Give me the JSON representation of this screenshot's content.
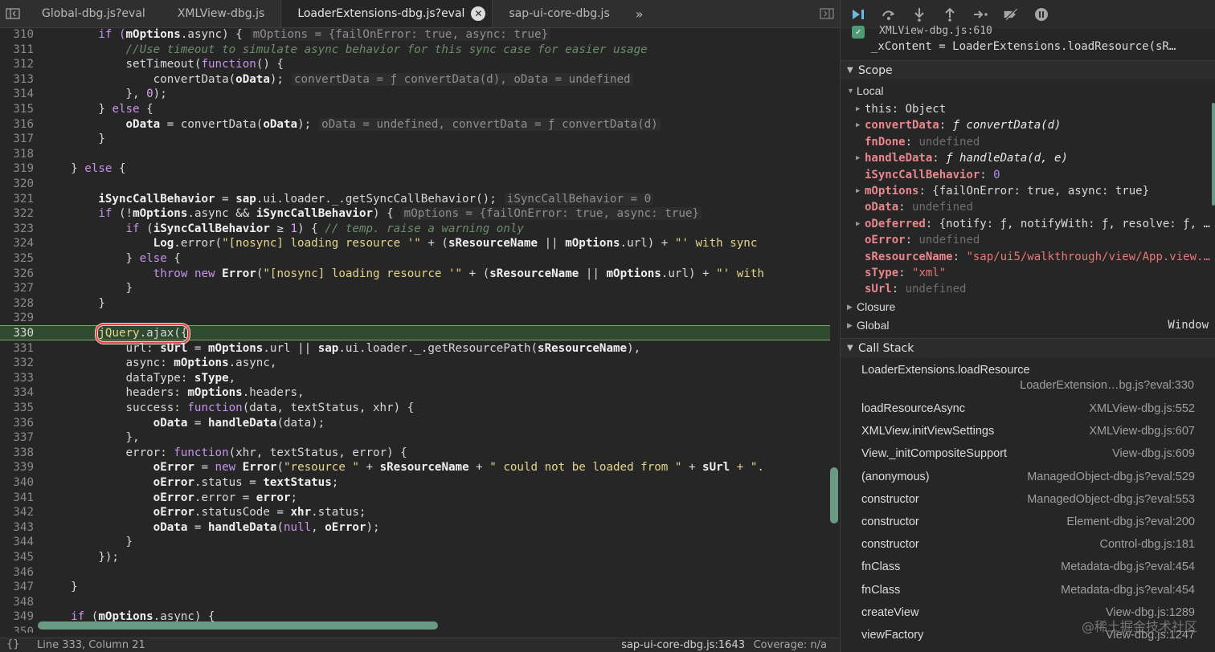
{
  "tabs": [
    {
      "label": "Global-dbg.js?eval"
    },
    {
      "label": "XMLView-dbg.js"
    },
    {
      "label": "LoaderExtensions-dbg.js?eval",
      "active": true
    },
    {
      "label": "sap-ui-core-dbg.js"
    }
  ],
  "icons": {
    "sidebar_toggle": "sidebar-toggle-icon",
    "close": "close-icon",
    "overflow": "double-chevron-right-icon",
    "right_panel": "panel-right-icon"
  },
  "colors": {
    "exec_line_bg": "#2f4a2e",
    "exec_line_border": "#6fb15f",
    "highlight_box": "#e04343",
    "keyword": "#c792ea",
    "scrollbar": "#6b9a84"
  },
  "code": {
    "lines": [
      {
        "n": "310"
      },
      {
        "n": "311"
      },
      {
        "n": "312"
      },
      {
        "n": "313"
      },
      {
        "n": "314"
      },
      {
        "n": "315"
      },
      {
        "n": "316"
      },
      {
        "n": "317"
      },
      {
        "n": "318"
      },
      {
        "n": "319"
      },
      {
        "n": "320"
      },
      {
        "n": "321"
      },
      {
        "n": "322"
      },
      {
        "n": "323"
      },
      {
        "n": "324"
      },
      {
        "n": "325"
      },
      {
        "n": "326"
      },
      {
        "n": "327"
      },
      {
        "n": "328"
      },
      {
        "n": "329"
      },
      {
        "n": "330"
      },
      {
        "n": "331"
      },
      {
        "n": "332"
      },
      {
        "n": "333"
      },
      {
        "n": "334"
      },
      {
        "n": "335"
      },
      {
        "n": "336"
      },
      {
        "n": "337"
      },
      {
        "n": "338"
      },
      {
        "n": "339"
      },
      {
        "n": "340"
      },
      {
        "n": "341"
      },
      {
        "n": "342"
      },
      {
        "n": "343"
      },
      {
        "n": "344"
      },
      {
        "n": "345"
      },
      {
        "n": "346"
      },
      {
        "n": "347"
      },
      {
        "n": "348"
      },
      {
        "n": "349"
      },
      {
        "n": "350"
      }
    ],
    "text": {
      "l310_a": "if (",
      "l310_b": "mOptions",
      "l310_c": ".async) {",
      "l310_inl": "mOptions = {failOnError: true, async: true}",
      "l311": "//Use timeout to simulate async behavior for this sync case for easier usage",
      "l312_a": "setTimeout(",
      "l312_b": "function",
      "l312_c": "() {",
      "l313_a": "convertData(",
      "l313_b": "oData",
      "l313_c": ");",
      "l313_inl": "convertData = ƒ convertData(d), oData = undefined",
      "l314_a": "}, ",
      "l314_b": "0",
      "l314_c": ");",
      "l315_a": "} ",
      "l315_b": "else",
      "l315_c": " {",
      "l316_a": "oData",
      "l316_b": " = convertData(",
      "l316_c": "oData",
      "l316_d": ");",
      "l316_inl": "oData = undefined, convertData = ƒ convertData(d)",
      "l317": "}",
      "l319_a": "} ",
      "l319_b": "else",
      "l319_c": " {",
      "l321_a": "iSyncCallBehavior",
      "l321_b": " = ",
      "l321_c": "sap",
      "l321_d": ".ui.loader._.getSyncCallBehavior();",
      "l321_inl": "iSyncCallBehavior = 0",
      "l322_a": "if",
      "l322_b": " (!",
      "l322_c": "mOptions",
      "l322_d": ".async && ",
      "l322_e": "iSyncCallBehavior",
      "l322_f": ") {",
      "l322_inl": "mOptions = {failOnError: true, async: true}",
      "l323_a": "if",
      "l323_b": " (",
      "l323_c": "iSyncCallBehavior",
      "l323_d": " ≥ ",
      "l323_e": "1",
      "l323_f": ") { ",
      "l323_g": "// temp. raise a warning only",
      "l324_a": "Log",
      "l324_b": ".error(",
      "l324_c": "\"[nosync] loading resource '\"",
      "l324_d": " + (",
      "l324_e": "sResourceName",
      "l324_f": " || ",
      "l324_g": "mOptions",
      "l324_h": ".url) + ",
      "l324_i": "\"' with sync",
      "l325_a": "} ",
      "l325_b": "else",
      "l325_c": " {",
      "l326_a": "throw",
      "l326_b": " ",
      "l326_c": "new",
      "l326_d": " ",
      "l326_e": "Error",
      "l326_f": "(",
      "l326_g": "\"[nosync] loading resource '\"",
      "l326_h": " + (",
      "l326_i": "sResourceName",
      "l326_j": " || ",
      "l326_k": "mOptions",
      "l326_l": ".url) + ",
      "l326_m": "\"' with",
      "l327": "}",
      "l328": "}",
      "l330_a": "jQuery",
      "l330_b": ".ajax({",
      "l331_a": "url: ",
      "l331_b": "sUrl",
      "l331_c": " = ",
      "l331_d": "mOptions",
      "l331_e": ".url || ",
      "l331_f": "sap",
      "l331_g": ".ui.loader._.getResourcePath(",
      "l331_h": "sResourceName",
      "l331_i": "),",
      "l332_a": "async: ",
      "l332_b": "mOptions",
      "l332_c": ".async,",
      "l333_a": "dataType: ",
      "l333_b": "sType",
      "l333_c": ",",
      "l334_a": "headers: ",
      "l334_b": "mOptions",
      "l334_c": ".headers,",
      "l335_a": "success: ",
      "l335_b": "function",
      "l335_c": "(data, textStatus, xhr) {",
      "l336_a": "oData",
      "l336_b": " = ",
      "l336_c": "handleData",
      "l336_d": "(data);",
      "l337": "},",
      "l338_a": "error: ",
      "l338_b": "function",
      "l338_c": "(xhr, textStatus, error) {",
      "l339_a": "oError",
      "l339_b": " = ",
      "l339_c": "new",
      "l339_d": " ",
      "l339_e": "Error",
      "l339_f": "(",
      "l339_g": "\"resource \"",
      "l339_h": " + ",
      "l339_i": "sResourceName",
      "l339_j": " + ",
      "l339_k": "\" could not be loaded from \"",
      "l339_l": " + ",
      "l339_m": "sUrl",
      "l339_n": " + \".",
      "l340_a": "oError",
      "l340_b": ".status = ",
      "l340_c": "textStatus",
      "l340_d": ";",
      "l341_a": "oError",
      "l341_b": ".error = ",
      "l341_c": "error",
      "l341_d": ";",
      "l342_a": "oError",
      "l342_b": ".statusCode = ",
      "l342_c": "xhr",
      "l342_d": ".status;",
      "l343_a": "oData",
      "l343_b": " = ",
      "l343_c": "handleData",
      "l343_d": "(",
      "l343_e": "null",
      "l343_f": ", ",
      "l343_g": "oError",
      "l343_h": ");",
      "l344": "}",
      "l345": "});",
      "l347": "}",
      "l349_a": "if",
      "l349_b": " (",
      "l349_c": "mOptions",
      "l349_d": ".async) {"
    }
  },
  "status": {
    "curly": "{}",
    "position": "Line 333, Column 21",
    "file": "sap-ui-core-dbg.js:1643",
    "coverage": "Coverage: n/a"
  },
  "debugger": {
    "toolbar": [
      {
        "name": "resume-icon",
        "glyph": "▶▍"
      },
      {
        "name": "step-over-icon",
        "glyph": "↷"
      },
      {
        "name": "step-into-icon",
        "glyph": "⤓"
      },
      {
        "name": "step-out-icon",
        "glyph": "⤒"
      },
      {
        "name": "step-icon",
        "glyph": "→•"
      },
      {
        "name": "deactivate-breakpoints-icon",
        "glyph": "⧸"
      },
      {
        "name": "pause-exceptions-icon",
        "glyph": "⏸"
      }
    ],
    "peek_line1": "XMLView-dbg.js:610",
    "peek_line2": "_xContent = LoaderExtensions.loadResource(sR…",
    "scope_title": "Scope",
    "local_title": "Local",
    "scope": [
      {
        "key": "this",
        "sep": ": ",
        "val": "Object",
        "expandable": true,
        "plain": true,
        "vt": "obj"
      },
      {
        "key": "convertData",
        "sep": ": ",
        "val": "ƒ convertData(d)",
        "expandable": true,
        "vt": "fn"
      },
      {
        "key": "fnDone",
        "sep": ": ",
        "val": "undefined",
        "expandable": false,
        "vt": "undef"
      },
      {
        "key": "handleData",
        "sep": ": ",
        "val": "ƒ handleData(d, e)",
        "expandable": true,
        "vt": "fn"
      },
      {
        "key": "iSyncCallBehavior",
        "sep": ": ",
        "val": "0",
        "expandable": false,
        "vt": "num"
      },
      {
        "key": "mOptions",
        "sep": ": ",
        "val": "{failOnError: true, async: true}",
        "expandable": true,
        "vt": "obj"
      },
      {
        "key": "oData",
        "sep": ": ",
        "val": "undefined",
        "expandable": false,
        "vt": "undef"
      },
      {
        "key": "oDeferred",
        "sep": ": ",
        "val": "{notify: ƒ, notifyWith: ƒ, resolve: ƒ, …",
        "expandable": true,
        "vt": "obj"
      },
      {
        "key": "oError",
        "sep": ": ",
        "val": "undefined",
        "expandable": false,
        "vt": "undef"
      },
      {
        "key": "sResourceName",
        "sep": ": ",
        "val": "\"sap/ui5/walkthrough/view/App.view.…",
        "expandable": false,
        "vt": "str"
      },
      {
        "key": "sType",
        "sep": ": ",
        "val": "\"xml\"",
        "expandable": false,
        "vt": "str"
      },
      {
        "key": "sUrl",
        "sep": ": ",
        "val": "undefined",
        "expandable": false,
        "vt": "undef"
      }
    ],
    "closure_label": "Closure",
    "global_label": "Global",
    "global_value": "Window",
    "callstack_title": "Call Stack",
    "callstack_first": {
      "fn": "LoaderExtensions.loadResource",
      "loc": "LoaderExtension…bg.js?eval:330"
    },
    "callstack": [
      {
        "fn": "loadResourceAsync",
        "loc": "XMLView-dbg.js:552"
      },
      {
        "fn": "XMLView.initViewSettings",
        "loc": "XMLView-dbg.js:607"
      },
      {
        "fn": "View._initCompositeSupport",
        "loc": "View-dbg.js:609"
      },
      {
        "fn": "(anonymous)",
        "loc": "ManagedObject-dbg.js?eval:529"
      },
      {
        "fn": "constructor",
        "loc": "ManagedObject-dbg.js?eval:553"
      },
      {
        "fn": "constructor",
        "loc": "Element-dbg.js?eval:200"
      },
      {
        "fn": "constructor",
        "loc": "Control-dbg.js:181"
      },
      {
        "fn": "fnClass",
        "loc": "Metadata-dbg.js?eval:454"
      },
      {
        "fn": "fnClass",
        "loc": "Metadata-dbg.js?eval:454"
      },
      {
        "fn": "createView",
        "loc": "View-dbg.js:1289"
      },
      {
        "fn": "viewFactory",
        "loc": "View-dbg.js:1247"
      }
    ]
  },
  "watermark": "@稀土掘金技术社区"
}
